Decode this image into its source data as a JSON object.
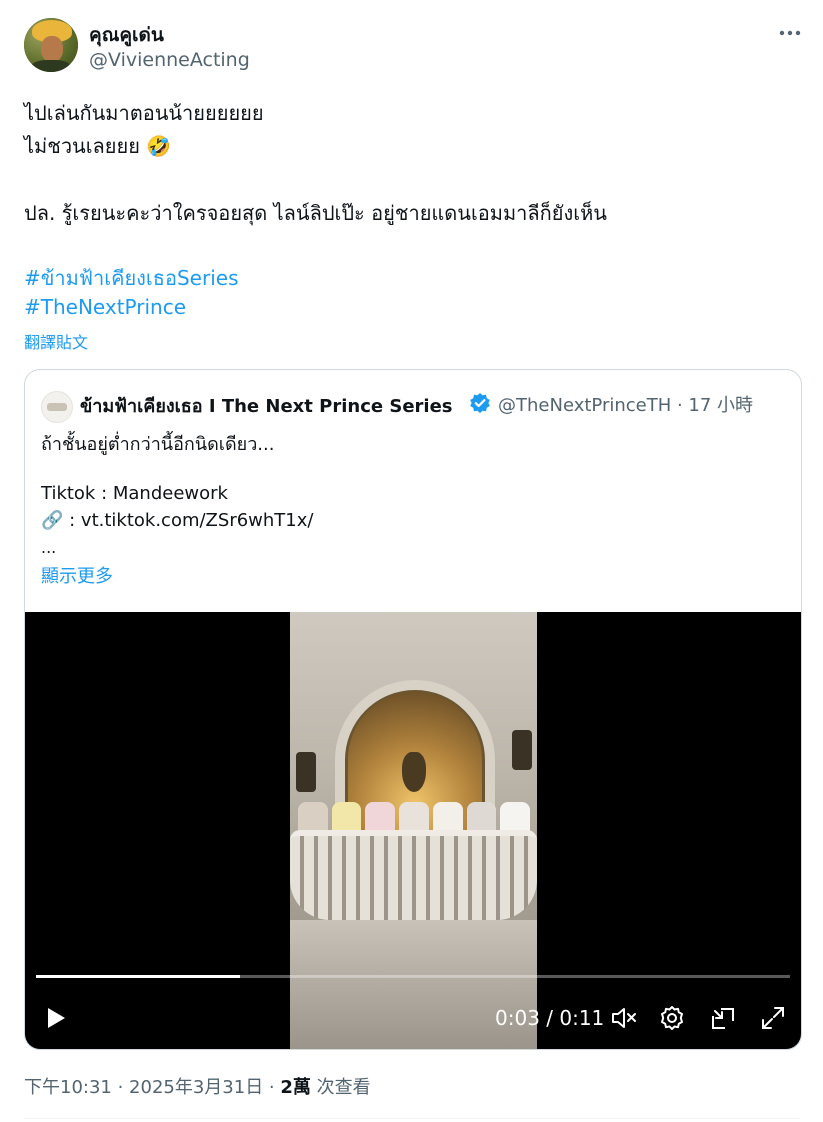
{
  "author": {
    "display_name": "คุณคูเด่น",
    "handle": "@VivienneActing"
  },
  "tweet": {
    "lines": [
      "ไปเล่นกันมาตอนน้ายยยยยย",
      "ไม่ชวนเลยยย 🤣",
      "ปล. รู้เรยนะคะว่าใครจอยสุด ไลน์ลิปเป๊ะ อยู่ชายแดนเอมมาลีก็ยังเห็น"
    ],
    "hashtags": [
      "#ข้ามฟ้าเคียงเธอSeries",
      "#TheNextPrince"
    ],
    "translate_label": "翻譯貼文"
  },
  "quote": {
    "display_name": "ข้ามฟ้าเคียงเธอ I The Next Prince Series",
    "verified": true,
    "handle_time": "@TheNextPrinceTH · 17 小時",
    "lines": [
      "ถ้าชั้นอยู่ต่ำกว่านี้อีกนิดเดียว...",
      "Tiktok : Mandeework",
      "🔗 :  vt.tiktok.com/ZSr6whT1x/",
      "..."
    ],
    "show_more_label": "顯示更多"
  },
  "video": {
    "progress": 0.27,
    "time_readout": "0:03 / 0:11",
    "state": "paused",
    "controls": [
      "play-icon",
      "mute-icon",
      "settings-gear-icon",
      "pip-icon",
      "fullscreen-icon"
    ]
  },
  "meta": {
    "timestamp": "下午10:31 · 2025年3月31日 · ",
    "views_count": "2萬",
    "views_label": " 次查看"
  },
  "colors": {
    "text_primary": "#0f1419",
    "text_secondary": "#536471",
    "link": "#1d9bf0",
    "border": "#cfd9de"
  }
}
